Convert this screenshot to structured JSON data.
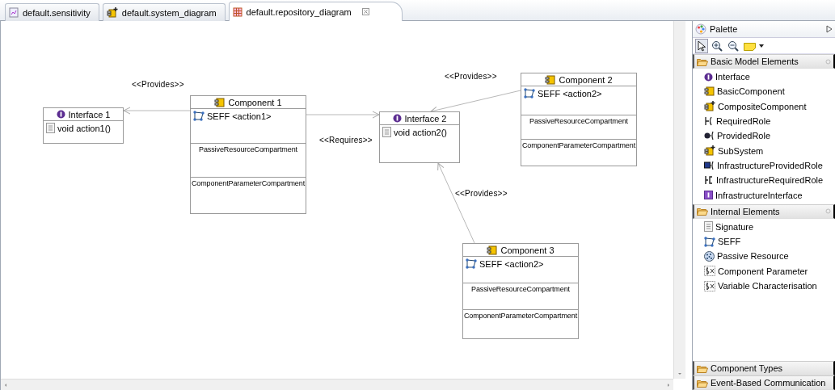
{
  "tabs": [
    {
      "label": "default.sensitivity",
      "selected": false
    },
    {
      "label": "default.system_diagram",
      "selected": false
    },
    {
      "label": "default.repository_diagram",
      "selected": true
    }
  ],
  "diagram": {
    "nodes": [
      {
        "kind": "interface",
        "name": "Interface 1",
        "signatures": [
          "void action1()"
        ]
      },
      {
        "kind": "component",
        "name": "Component 1",
        "seffs": [
          "SEFF <action1>"
        ],
        "compartments": [
          "PassiveResourceCompartment",
          "ComponentParameterCompartment"
        ]
      },
      {
        "kind": "interface",
        "name": "Interface 2",
        "signatures": [
          "void action2()"
        ]
      },
      {
        "kind": "component",
        "name": "Component 2",
        "seffs": [
          "SEFF <action2>"
        ],
        "compartments": [
          "PassiveResourceCompartment",
          "ComponentParameterCompartment"
        ]
      },
      {
        "kind": "component",
        "name": "Component 3",
        "seffs": [
          "SEFF <action2>"
        ],
        "compartments": [
          "PassiveResourceCompartment",
          "ComponentParameterCompartment"
        ]
      }
    ],
    "edges": [
      {
        "label": "<<Provides>>"
      },
      {
        "label": "<<Requires>>"
      },
      {
        "label": "<<Provides>>"
      },
      {
        "label": "<<Provides>>"
      }
    ]
  },
  "palette": {
    "title": "Palette",
    "tools": [
      {
        "kind": "select",
        "selected": true
      },
      {
        "kind": "zoom-in",
        "selected": false
      },
      {
        "kind": "zoom-out",
        "selected": false
      },
      {
        "kind": "note",
        "selected": false
      }
    ],
    "groups": [
      {
        "label": "Basic Model Elements",
        "expanded": true,
        "items": [
          "Interface",
          "BasicComponent",
          "CompositeComponent",
          "RequiredRole",
          "ProvidedRole",
          "SubSystem",
          "InfrastructureProvidedRole",
          "InfrastructureRequiredRole",
          "InfrastructureInterface"
        ]
      },
      {
        "label": "Internal Elements",
        "expanded": true,
        "items": [
          "Signature",
          "SEFF",
          "Passive Resource",
          "Component Parameter",
          "Variable Characterisation"
        ]
      },
      {
        "label": "Component Types",
        "expanded": false
      },
      {
        "label": "Event-Based Communication",
        "expanded": false
      }
    ]
  }
}
